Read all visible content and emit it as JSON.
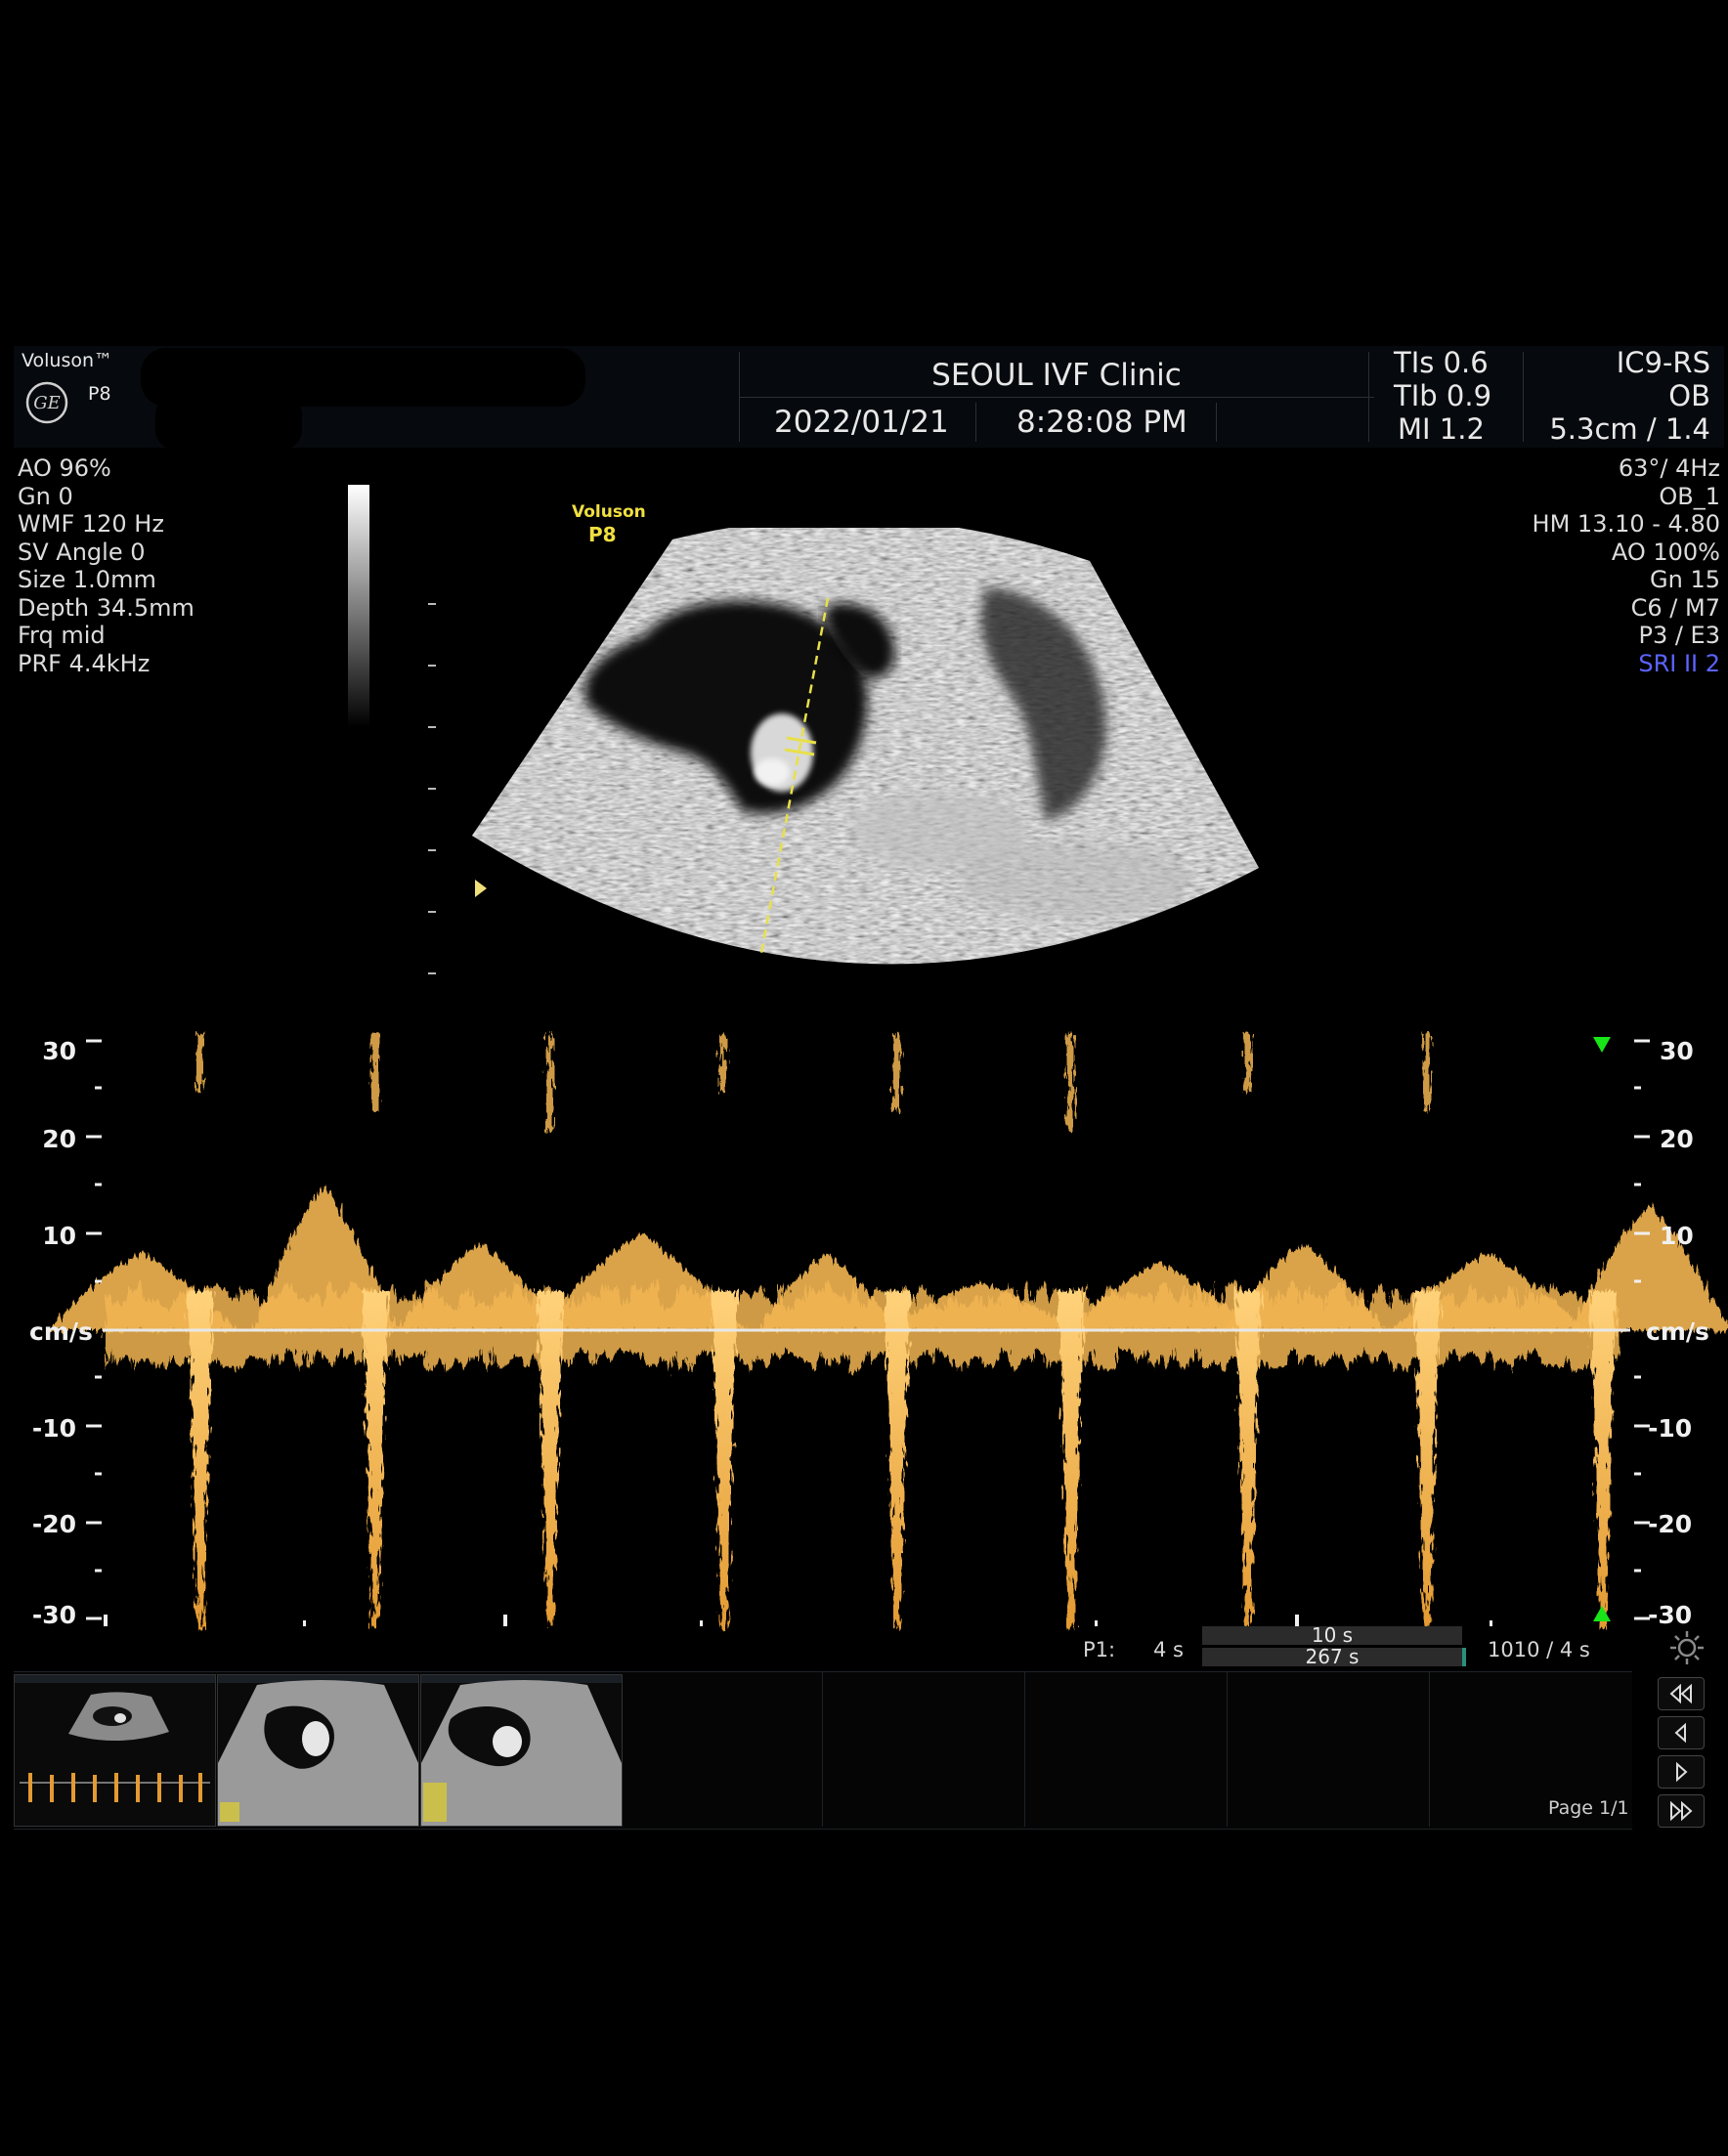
{
  "header": {
    "brand": "Voluson™",
    "brand_logo": "GE",
    "model": "P8",
    "clinic": "SEOUL IVF Clinic",
    "date": "2022/01/21",
    "time": "8:28:08 PM",
    "tis": "TIs 0.6",
    "tib": "TIb 0.9",
    "mi": "MI 1.2",
    "probe": "IC9-RS",
    "exam": "OB",
    "depth_zoom": "5.3cm / 1.4"
  },
  "left_params": [
    "AO 96%",
    "Gn  0",
    "WMF 120 Hz",
    "SV Angle  0",
    "Size  1.0mm",
    "Depth 34.5mm",
    "Frq mid",
    "PRF  4.4kHz"
  ],
  "right_params": [
    "63°/  4Hz",
    "OB_1",
    "HM  13.10 - 4.80",
    "AO 100%",
    "Gn  15",
    "C6 / M7",
    "P3 / E3"
  ],
  "right_param_highlight": "SRI II 2",
  "image_label": {
    "line1": "Voluson",
    "line2": "P8"
  },
  "doppler": {
    "unit": "cm/s",
    "ticks": [
      "30",
      "20",
      "10",
      "-10",
      "-20",
      "-30"
    ]
  },
  "chart_data": {
    "type": "area",
    "title": "",
    "ylabel": "cm/s",
    "ylim": [
      -30,
      30
    ],
    "yticks": [
      30,
      20,
      10,
      0,
      -10,
      -20,
      -30
    ],
    "series": [
      {
        "values": [
          -31,
          -31,
          -31,
          -31,
          -31,
          -31,
          -31,
          -31,
          -31,
          -31
        ]
      },
      {
        "values": [
          8,
          15,
          9,
          10,
          8,
          5,
          7,
          9,
          8,
          13
        ]
      }
    ]
  },
  "cine": {
    "label": "P1:",
    "duration": "4 s",
    "box_top": "10 s",
    "box_bottom": "267 s",
    "frames": "1010 / 4 s"
  },
  "page": "Page 1/1",
  "colors": {
    "doppler": "#f2b552",
    "caliper": "#e8e04a",
    "header_bg": "#06090d",
    "sri": "#5c63ff",
    "marker": "#19e619"
  },
  "icons": {
    "settings": "gear-icon",
    "first": "double-left-icon",
    "prev": "left-icon",
    "next": "right-icon",
    "last": "double-right-icon"
  }
}
